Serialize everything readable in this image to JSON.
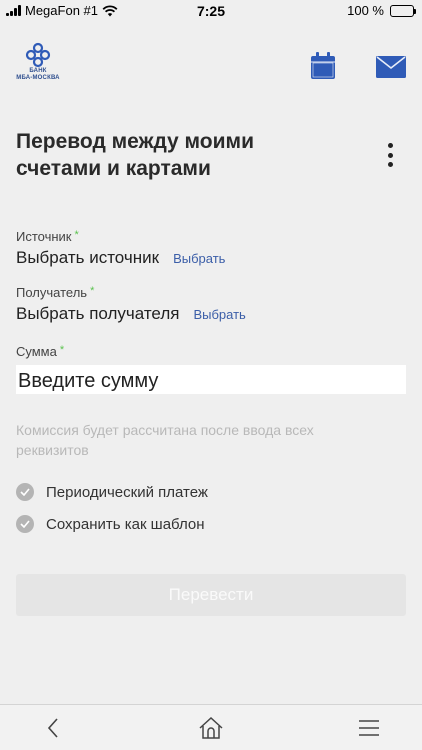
{
  "status_bar": {
    "carrier": "MegaFon #1",
    "time": "7:25",
    "battery_text": "100 %",
    "battery_level": 1.0
  },
  "header": {
    "logo_line1": "БАНК",
    "logo_line2": "МБА-МОСКВА",
    "icons": [
      "calendar-icon",
      "mail-icon"
    ],
    "brand_color": "#2f5bb7"
  },
  "page": {
    "title_line1": "Перевод между моими",
    "title_line2": "счетами и картами",
    "menu_icon": "more-vertical-icon"
  },
  "form": {
    "required_mark": "*",
    "source": {
      "label": "Источник",
      "value": "Выбрать источник",
      "link": "Выбрать"
    },
    "recipient": {
      "label": "Получатель",
      "value": "Выбрать получателя",
      "link": "Выбрать"
    },
    "amount": {
      "label": "Сумма",
      "placeholder": "Введите сумму",
      "value": ""
    },
    "commission_hint": "Комиссия будет рассчитана после ввода всех реквизитов",
    "options": [
      {
        "label": "Периодический платеж"
      },
      {
        "label": "Сохранить как шаблон"
      }
    ],
    "submit_label": "Перевести"
  },
  "tab_bar": {
    "icons": [
      "back-icon",
      "home-icon",
      "menu-icon"
    ]
  },
  "colors": {
    "link": "#3b5ea8",
    "required": "#5ac24e",
    "hint": "#b8b8b8",
    "background": "#efefef"
  }
}
